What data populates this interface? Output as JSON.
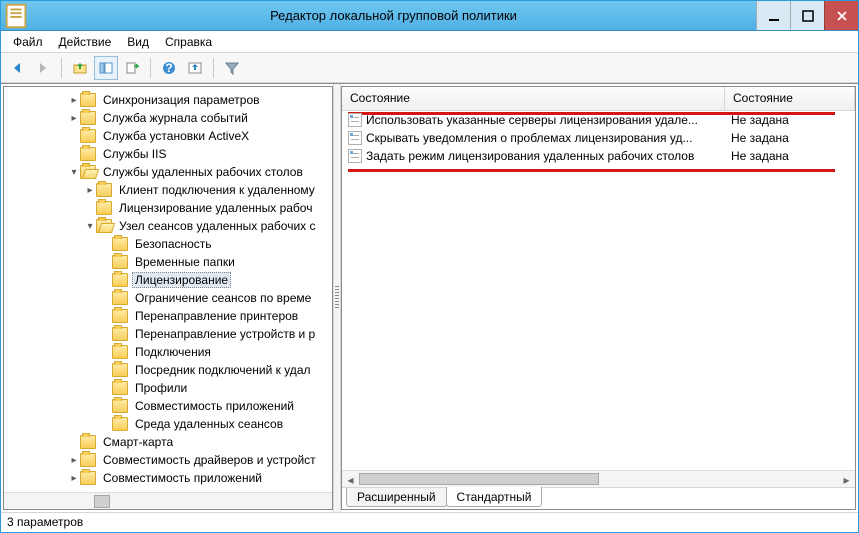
{
  "window": {
    "title": "Редактор локальной групповой политики"
  },
  "menu": {
    "file": "Файл",
    "action": "Действие",
    "view": "Вид",
    "help": "Справка"
  },
  "tree": [
    {
      "indent": 4,
      "exp": ">",
      "icon": "closed",
      "label": "Синхронизация параметров"
    },
    {
      "indent": 4,
      "exp": ">",
      "icon": "closed",
      "label": "Служба журнала событий"
    },
    {
      "indent": 4,
      "exp": "",
      "icon": "closed",
      "label": "Служба установки ActiveX"
    },
    {
      "indent": 4,
      "exp": "",
      "icon": "closed",
      "label": "Службы IIS"
    },
    {
      "indent": 4,
      "exp": "v",
      "icon": "open",
      "label": "Службы удаленных рабочих столов"
    },
    {
      "indent": 5,
      "exp": ">",
      "icon": "closed",
      "label": "Клиент подключения к удаленному"
    },
    {
      "indent": 5,
      "exp": "",
      "icon": "closed",
      "label": "Лицензирование удаленных рабоч"
    },
    {
      "indent": 5,
      "exp": "v",
      "icon": "open",
      "label": "Узел сеансов удаленных рабочих с"
    },
    {
      "indent": 6,
      "exp": "",
      "icon": "closed",
      "label": "Безопасность"
    },
    {
      "indent": 6,
      "exp": "",
      "icon": "closed",
      "label": "Временные папки"
    },
    {
      "indent": 6,
      "exp": "",
      "icon": "closed",
      "label": "Лицензирование",
      "selected": true
    },
    {
      "indent": 6,
      "exp": "",
      "icon": "closed",
      "label": "Ограничение сеансов по време"
    },
    {
      "indent": 6,
      "exp": "",
      "icon": "closed",
      "label": "Перенаправление принтеров"
    },
    {
      "indent": 6,
      "exp": "",
      "icon": "closed",
      "label": "Перенаправление устройств и р"
    },
    {
      "indent": 6,
      "exp": "",
      "icon": "closed",
      "label": "Подключения"
    },
    {
      "indent": 6,
      "exp": "",
      "icon": "closed",
      "label": "Посредник подключений к удал"
    },
    {
      "indent": 6,
      "exp": "",
      "icon": "closed",
      "label": "Профили"
    },
    {
      "indent": 6,
      "exp": "",
      "icon": "closed",
      "label": "Совместимость приложений"
    },
    {
      "indent": 6,
      "exp": "",
      "icon": "closed",
      "label": "Среда удаленных сеансов"
    },
    {
      "indent": 4,
      "exp": "",
      "icon": "closed",
      "label": "Смарт-карта"
    },
    {
      "indent": 4,
      "exp": ">",
      "icon": "closed",
      "label": "Совместимость драйверов и устройст"
    },
    {
      "indent": 4,
      "exp": ">",
      "icon": "closed",
      "label": "Совместимость приложений"
    }
  ],
  "list": {
    "columns": {
      "name": "Состояние",
      "state": "Состояние"
    },
    "rows": [
      {
        "name": "Использовать указанные серверы лицензирования удале...",
        "state": "Не задана"
      },
      {
        "name": "Скрывать уведомления о проблемах лицензирования уд...",
        "state": "Не задана"
      },
      {
        "name": "Задать режим лицензирования удаленных рабочих столов",
        "state": "Не задана"
      }
    ]
  },
  "tabs": {
    "extended": "Расширенный",
    "standard": "Стандартный"
  },
  "status": "3 параметров"
}
